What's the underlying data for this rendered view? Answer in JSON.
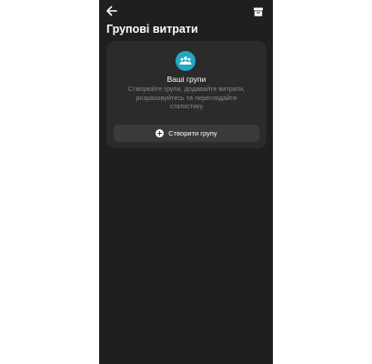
{
  "header": {
    "title": "Групові витрати",
    "back_icon": "arrow-left-icon",
    "archive_icon": "archive-icon"
  },
  "empty_state": {
    "icon": "group-icon",
    "title": "Ваші групи",
    "description": "Створюйте групи, додавайте витрати, розраховуйтесь та переглядайте статистику",
    "button_label": "Створити групу",
    "button_icon": "plus-circle-icon"
  },
  "colors": {
    "background": "#1f1f1f",
    "card": "#2b2b2b",
    "accent": "#22a7c4",
    "button": "#3a3a3a"
  }
}
